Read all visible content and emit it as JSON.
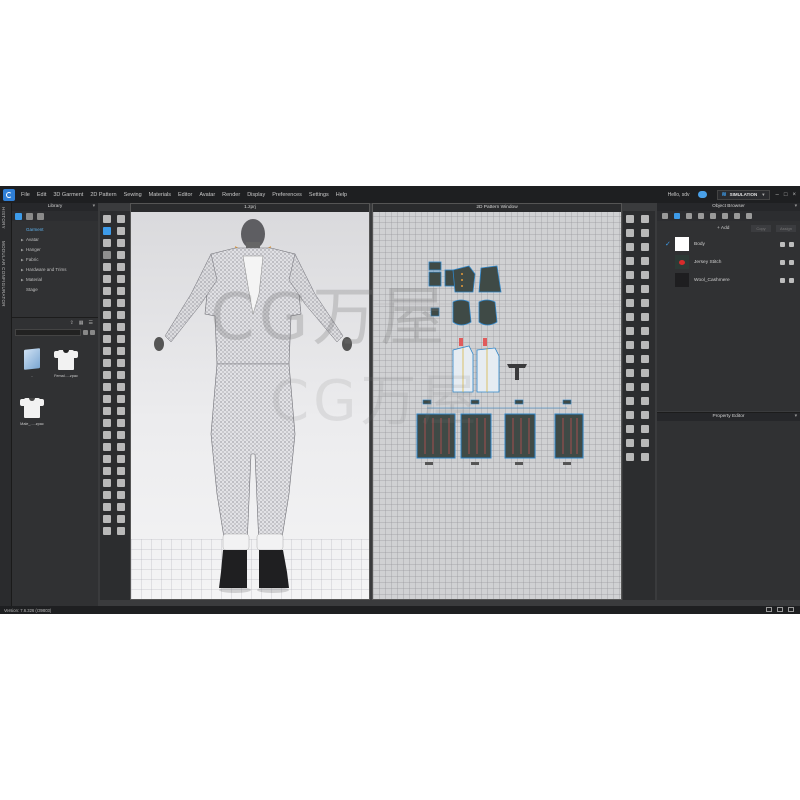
{
  "menubar": {
    "items": [
      "File",
      "Edit",
      "3D Garment",
      "2D Pattern",
      "Sewing",
      "Materials",
      "Editor",
      "Avatar",
      "Render",
      "Display",
      "Preferences",
      "Settings",
      "Help"
    ],
    "user_greeting": "Hello, sdv",
    "mode_label": "SIMULATION"
  },
  "side_tabs": [
    "HISTORY",
    "MODULAR CONFIGURATOR"
  ],
  "library": {
    "title": "Library",
    "tree": [
      "Garment",
      "Avatar",
      "Hanger",
      "Fabric",
      "Hardware and Trims",
      "Material",
      "Stage"
    ],
    "items": [
      {
        "caption": "..",
        "icon": "folder-up-icon"
      },
      {
        "caption": "Femal.....zpac",
        "icon": "tshirt-icon"
      },
      {
        "caption": "Male_.....zpac",
        "icon": "tshirt-icon"
      }
    ]
  },
  "window_3d": {
    "title": "1.zprj"
  },
  "window_2d": {
    "title": "2D Pattern Window"
  },
  "object_browser": {
    "title": "Object Browser",
    "add_label": "+ Add",
    "copy_label": "Copy",
    "assign_label": "Assign",
    "rows": [
      {
        "label": "Body",
        "checked": true,
        "swatch": "#ffffff"
      },
      {
        "label": "Jersey Stitch",
        "checked": false,
        "swatch": "#2d3a36"
      },
      {
        "label": "Wool_Cashmere",
        "checked": false,
        "swatch": "#1e1e20"
      }
    ]
  },
  "property_editor": {
    "title": "Property Editor"
  },
  "status": {
    "version": "Version: 7.6.326 (r39803)"
  },
  "watermark": {
    "line1": "CG万屋",
    "line2": "CG万屋"
  },
  "colors": {
    "accent": "#3d9be9",
    "panel": "#303133",
    "menubar": "#1e1f21",
    "pattern_fill": "#3f4a46",
    "pattern_outline": "#2f86c9"
  }
}
